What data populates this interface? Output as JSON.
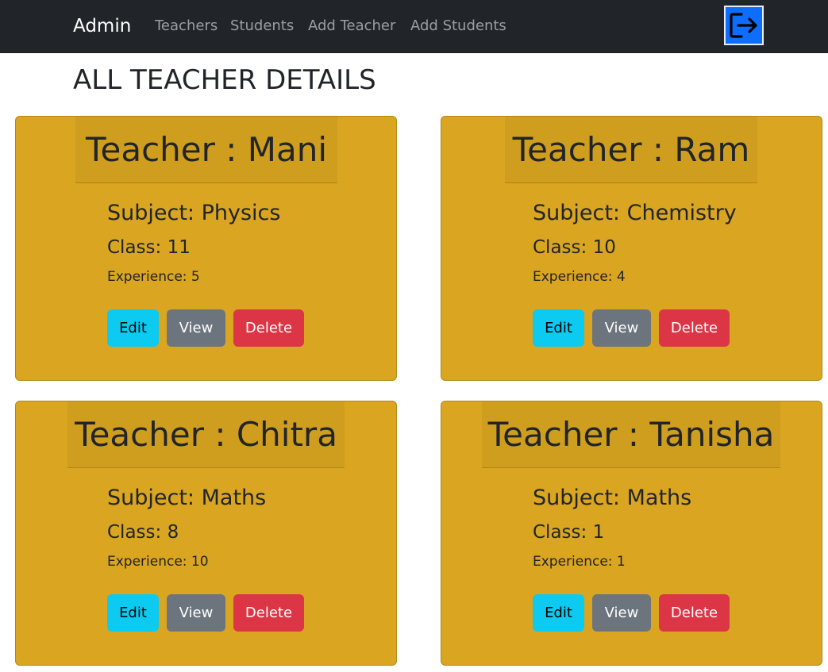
{
  "navbar": {
    "brand": "Admin",
    "links": [
      "Teachers",
      "Students",
      "Add Teacher",
      "Add Students"
    ],
    "logout_icon": "logout-icon",
    "logout_color": "#0d6efd"
  },
  "page": {
    "title": "ALL TEACHER DETAILS"
  },
  "colors": {
    "card_bg": "#daa520",
    "edit": "#0dcaf0",
    "view": "#6c757d",
    "delete": "#dc3545"
  },
  "teachers": [
    {
      "header": "Teacher : Mani",
      "subject": "Subject: Physics",
      "class": "Class: 11",
      "experience": "Experience: 5",
      "edit_label": "Edit",
      "view_label": "View",
      "delete_label": "Delete"
    },
    {
      "header": "Teacher : Ram",
      "subject": "Subject: Chemistry",
      "class": "Class: 10",
      "experience": "Experience: 4",
      "edit_label": "Edit",
      "view_label": "View",
      "delete_label": "Delete"
    },
    {
      "header": "Teacher : Chitra",
      "subject": "Subject: Maths",
      "class": "Class: 8",
      "experience": "Experience: 10",
      "edit_label": "Edit",
      "view_label": "View",
      "delete_label": "Delete"
    },
    {
      "header": "Teacher : Tanisha",
      "subject": "Subject: Maths",
      "class": "Class: 1",
      "experience": "Experience: 1",
      "edit_label": "Edit",
      "view_label": "View",
      "delete_label": "Delete"
    }
  ]
}
